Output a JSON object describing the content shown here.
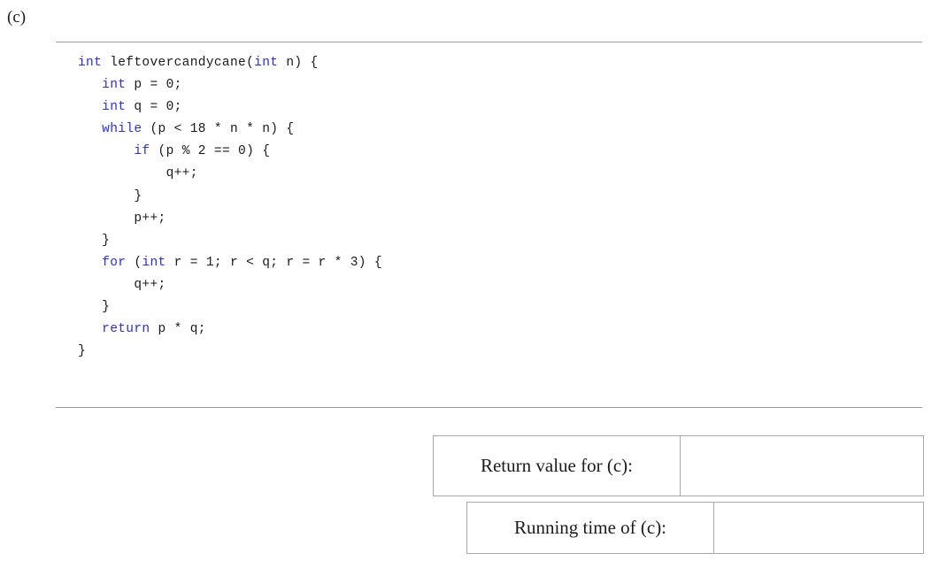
{
  "part": {
    "label": "(c)"
  },
  "code": {
    "language": "c",
    "function_name": "leftovercandycane",
    "keyword_color": "#2e2ed6",
    "text_color": "#1a1a1a",
    "lines": [
      [
        {
          "t": "int",
          "k": true
        },
        {
          "t": " leftovercandycane(",
          "k": false
        },
        {
          "t": "int",
          "k": true
        },
        {
          "t": " n) {",
          "k": false
        }
      ],
      [
        {
          "t": "   ",
          "k": false
        },
        {
          "t": "int",
          "k": true
        },
        {
          "t": " p = 0;",
          "k": false
        }
      ],
      [
        {
          "t": "   ",
          "k": false
        },
        {
          "t": "int",
          "k": true
        },
        {
          "t": " q = 0;",
          "k": false
        }
      ],
      [
        {
          "t": "   ",
          "k": false
        },
        {
          "t": "while",
          "k": true
        },
        {
          "t": " (p < 18 * n * n) {",
          "k": false
        }
      ],
      [
        {
          "t": "       ",
          "k": false
        },
        {
          "t": "if",
          "k": true
        },
        {
          "t": " (p % 2 == 0) {",
          "k": false
        }
      ],
      [
        {
          "t": "           q++;",
          "k": false
        }
      ],
      [
        {
          "t": "       }",
          "k": false
        }
      ],
      [
        {
          "t": "       p++;",
          "k": false
        }
      ],
      [
        {
          "t": "   }",
          "k": false
        }
      ],
      [
        {
          "t": "   ",
          "k": false
        },
        {
          "t": "for",
          "k": true
        },
        {
          "t": " (",
          "k": false
        },
        {
          "t": "int",
          "k": true
        },
        {
          "t": " r = 1; r < q; r = r * 3) {",
          "k": false
        }
      ],
      [
        {
          "t": "       q++;",
          "k": false
        }
      ],
      [
        {
          "t": "   }",
          "k": false
        }
      ],
      [
        {
          "t": "   ",
          "k": false
        },
        {
          "t": "return",
          "k": true
        },
        {
          "t": " p * q;",
          "k": false
        }
      ],
      [
        {
          "t": "}",
          "k": false
        }
      ]
    ],
    "plain_text": "int leftovercandycane(int n) {\n   int p = 0;\n   int q = 0;\n   while (p < 18 * n * n) {\n       if (p % 2 == 0) {\n           q++;\n       }\n       p++;\n   }\n   for (int r = 1; r < q; r = r * 3) {\n       q++;\n   }\n   return p * q;\n}"
  },
  "answers": {
    "return_value": {
      "label": "Return value for (c):",
      "value": ""
    },
    "running_time": {
      "label": "Running time of (c):",
      "value": ""
    }
  }
}
